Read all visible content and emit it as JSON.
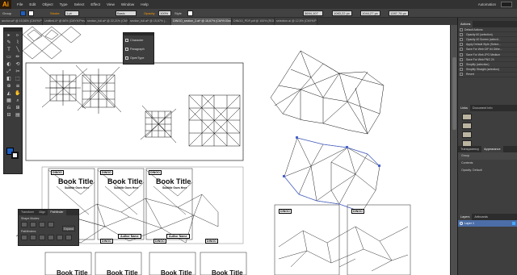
{
  "app": {
    "logo": "Ai"
  },
  "menu": [
    "File",
    "Edit",
    "Object",
    "Type",
    "Select",
    "Effect",
    "View",
    "Window",
    "Help"
  ],
  "workspace": {
    "label": "Automation"
  },
  "controlbar": {
    "selection_label": "Group",
    "stroke_label": "Stroke",
    "stroke_value": "1 pt",
    "brush_label": "Basic",
    "opacity_label": "Opacity",
    "opacity_value": "100%",
    "style_label": "Style",
    "x_value": "3694,107 px",
    "y_value": "1083,22 px",
    "w_value": "1044,27 px",
    "h_value": "1287,76 px"
  },
  "tabs": [
    "anchor.ai* @ 15,56% (CMYK/Previ...",
    "Untitled-6* @ 66% (CMYK/Previ...",
    "section_full.ai* @ 22,21% (CMYK...",
    "section_full.ai* @ 15,67% (...",
    "DINGO_section_2.ai* @ 16,67% (CMYK/GeoMesh)",
    "DINGO_PDF.pdf @ 100% (RGB/Previ...",
    "selection.ai @ 12,5% (CMYK/Previ..."
  ],
  "tools": [
    "▸",
    "▹",
    "✎",
    "⌇",
    "T",
    "╲",
    "▭",
    "✏",
    "◐",
    "⟲",
    "⤢",
    "✂",
    "◧",
    "⬚",
    "⊕",
    "≡",
    "◭",
    "✋",
    "▦",
    "⌕",
    "⎌",
    "⊞",
    "⊟",
    "▤"
  ],
  "character_panel": {
    "items": [
      {
        "label": "Character",
        "icon": "character-icon"
      },
      {
        "label": "Paragraph",
        "icon": "paragraph-icon"
      },
      {
        "label": "OpenType",
        "icon": "opentype-icon"
      }
    ]
  },
  "pathfinder": {
    "tabs": [
      "Transform",
      "Align",
      "Pathfinder"
    ],
    "shape_modes_label": "Shape Modes:",
    "pathfinders_label": "Pathfinders:",
    "expand_label": "Expand"
  },
  "panels": {
    "actions_tab": "Actions",
    "links_tab": "Links",
    "document_info_tab": "Document Info",
    "transparency_tab": "Transparency",
    "appearance_tab": "Appearance",
    "layers_tab": "Layers",
    "artboards_tab": "Artboards"
  },
  "actions": [
    {
      "label": "Default Actions",
      "folder": true
    },
    {
      "label": "Opacity 60 (selection)"
    },
    {
      "label": "Opacity 40 Screen (selecti..."
    },
    {
      "label": "Apply Default Style (Select..."
    },
    {
      "label": "Save For Web GIF 64 Dithe..."
    },
    {
      "label": "Save For Web JPG Medium"
    },
    {
      "label": "Save For Web PNG 24"
    },
    {
      "label": "Simplify (selection)"
    },
    {
      "label": "Simplify Straight (selection)"
    },
    {
      "label": "Revert"
    }
  ],
  "appearance": {
    "group": "Group",
    "contents": "Contents",
    "opacity": "Opacity: Default"
  },
  "layers": {
    "layer1": "Layer 1"
  },
  "canvas": {
    "book_label": "DINGO",
    "book_title": "Book Title",
    "book_subtitle": "Subtitle Goes Here",
    "author": "Author Name"
  },
  "colors": {
    "accent": "#1d5fc4",
    "selection": "#4a63c9",
    "layer_highlight": "#4b6ea8"
  }
}
